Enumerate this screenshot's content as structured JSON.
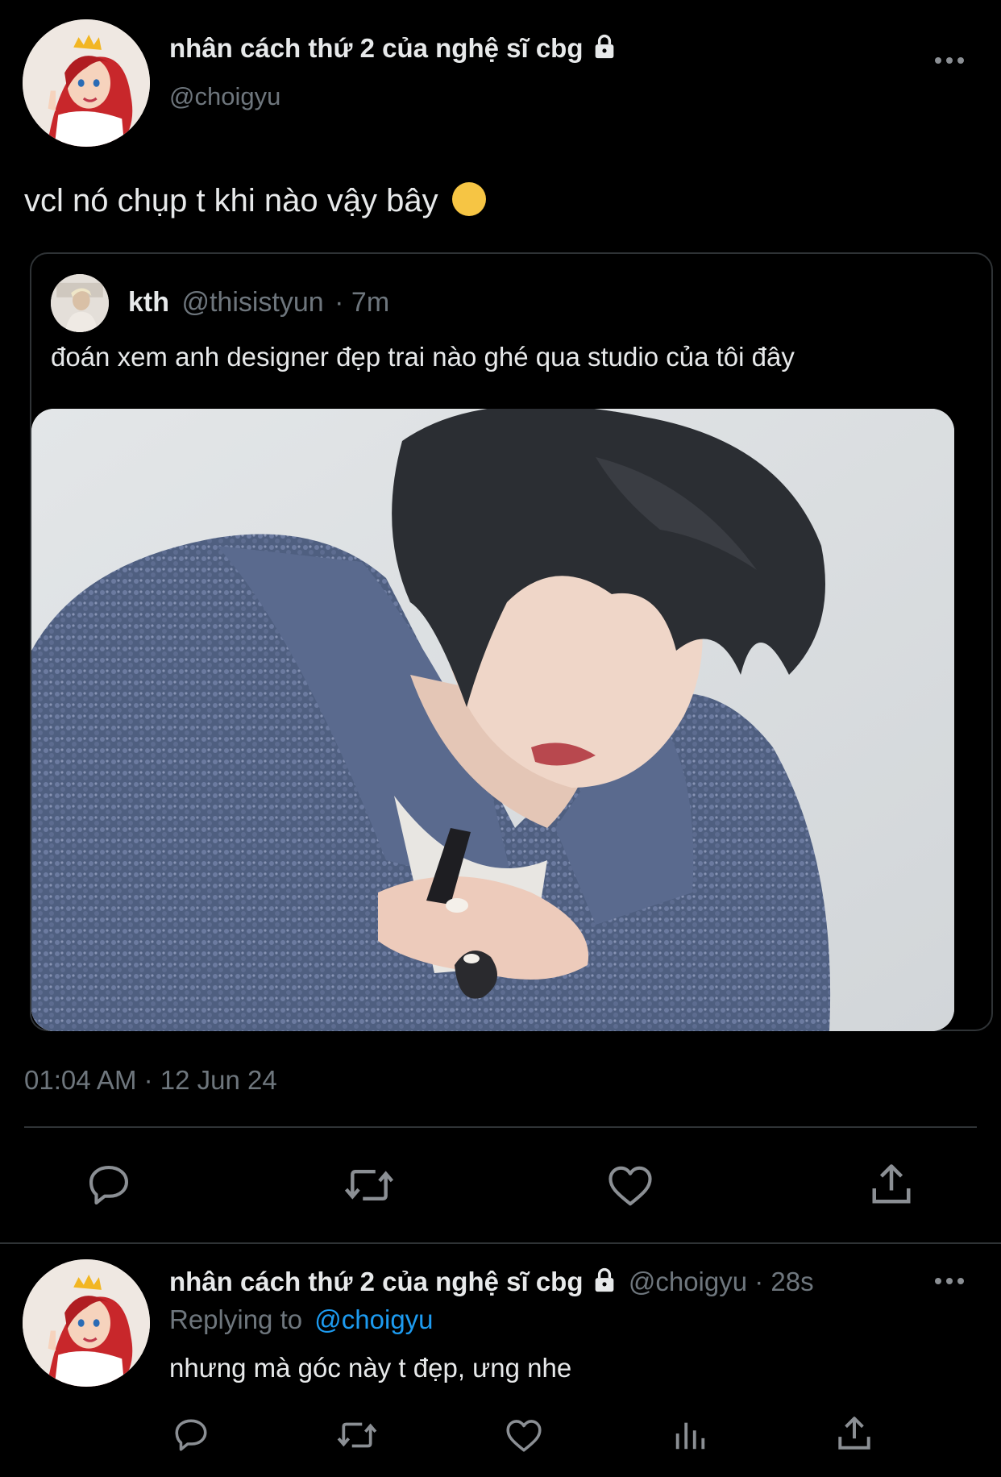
{
  "main_tweet": {
    "display_name": "nhân cách thứ 2 của nghệ sĩ cbg",
    "handle": "@choigyu",
    "text": "vcl nó chụp t khi nào vậy bây",
    "emoji": "🙂",
    "timestamp": "01:04 AM · 12 Jun 24",
    "avatar_icon": "ariel-avatar",
    "lock_icon": "lock-icon",
    "more_icon": "more-options-icon"
  },
  "quoted_tweet": {
    "display_name": "kth",
    "handle": "@thisistyun",
    "time": "· 7m",
    "text": "đoán xem anh designer đẹp trai nào ghé qua studio của tôi đây",
    "media_icon": "photo-of-person-in-blue-cardigan"
  },
  "actions": {
    "reply_icon": "reply-icon",
    "retweet_icon": "retweet-icon",
    "like_icon": "heart-icon",
    "share_icon": "share-icon",
    "views_icon": "analytics-icon"
  },
  "reply_tweet": {
    "display_name": "nhân cách thứ 2 của nghệ sĩ cbg",
    "handle_time": "@choigyu · 28s",
    "replying_prefix": "Replying to",
    "replying_handle": "@choigyu",
    "text": "nhưng mà góc này t đẹp, ưng nhe"
  },
  "colors": {
    "background": "#000000",
    "text": "#e7e9ea",
    "muted": "#6e767d",
    "link": "#1d9bf0",
    "divider": "#2f3336"
  }
}
